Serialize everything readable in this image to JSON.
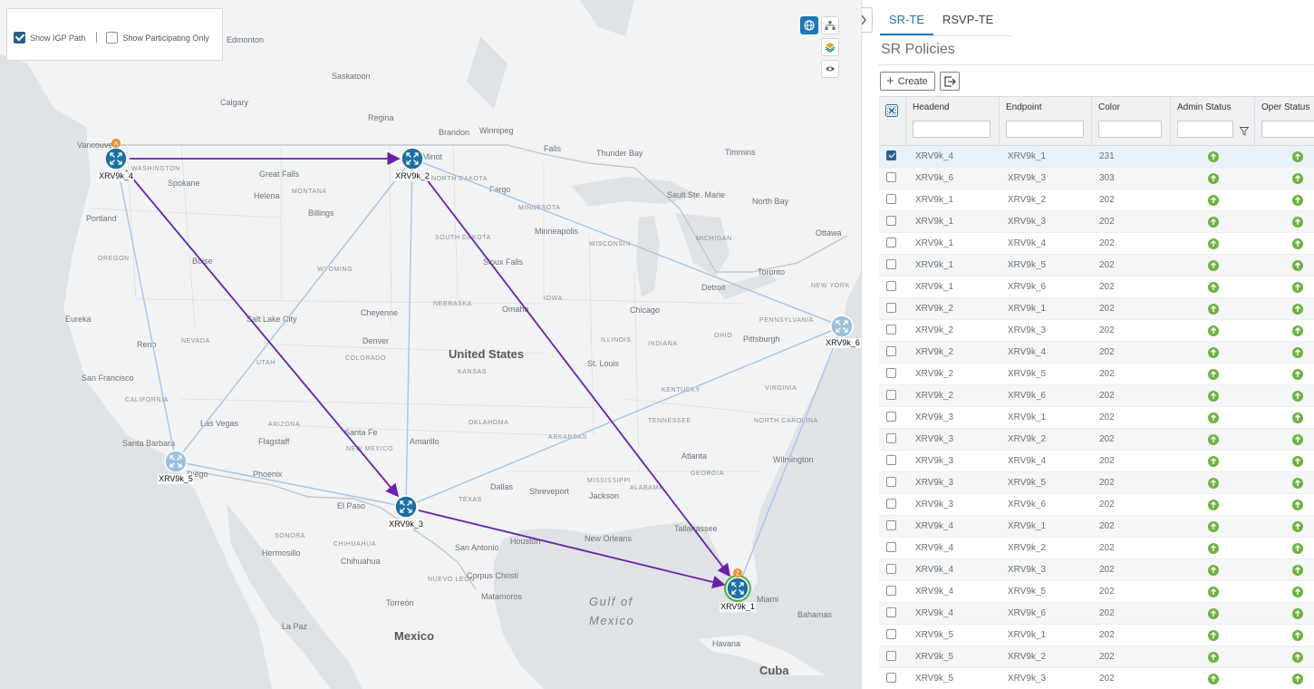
{
  "map": {
    "controls": {
      "show_igp_path": {
        "label": "Show IGP Path",
        "checked": true
      },
      "show_participating_only": {
        "label": "Show Participating Only",
        "checked": false
      }
    },
    "tool_icons": [
      "globe-icon",
      "topology-icon",
      "layers-icon",
      "eye-icon"
    ],
    "country_label": "United States",
    "mexico_label": "Mexico",
    "gulf_label_1": "Gulf of",
    "gulf_label_2": "Mexico",
    "cuba_label": "Cuba",
    "labels": {
      "edmonton": "Edmonton",
      "saskatoon": "Saskatoon",
      "calgary": "Calgary",
      "regina": "Regina",
      "brandon": "Brandon",
      "winnipeg": "Winnipeg",
      "thunder_bay": "Thunder Bay",
      "timmins": "Timmins",
      "vancouver": "Vancouver",
      "washington": "WASHINGTON",
      "spokane": "Spokane",
      "great_falls": "Great Falls",
      "helena": "Helena",
      "montana": "MONTANA",
      "billings": "Billings",
      "portland": "Portland",
      "oregon": "OREGON",
      "boise": "Boise",
      "wyoming": "WYOMING",
      "north_dakota": "NORTH DAKOTA",
      "fargo": "Fargo",
      "south_dakota": "SOUTH DAKOTA",
      "minnesota": "MINNESOTA",
      "minneapolis": "Minneapolis",
      "wisconsin": "WISCONSIN",
      "sioux_falls": "Sioux Falls",
      "michigan": "MICHIGAN",
      "ottawa": "Ottawa",
      "toronto": "Toronto",
      "new_york": "NEW YORK",
      "detroit": "Detroit",
      "chicago": "Chicago",
      "iowa": "IOWA",
      "nebraska": "NEBRASKA",
      "omaha": "Omaha",
      "illinois": "ILLINOIS",
      "indiana": "INDIANA",
      "ohio": "OHIO",
      "pittsburgh": "Pittsburgh",
      "pennsylvania": "PENNSYLVANIA",
      "eureka": "Eureka",
      "reno": "Reno",
      "nevada": "NEVADA",
      "salt_lake_city": "Salt Lake City",
      "utah": "UTAH",
      "cheyenne": "Cheyenne",
      "denver": "Denver",
      "colorado": "COLORADO",
      "kansas": "KANSAS",
      "st_louis": "St. Louis",
      "kentucky": "KENTUCKY",
      "virginia": "VIRGINIA",
      "san_francisco": "San Francisco",
      "california": "CALIFORNIA",
      "las_vegas": "Las Vegas",
      "arizona": "ARIZONA",
      "flagstaff": "Flagstaff",
      "santa_fe": "Santa Fe",
      "new_mexico": "NEW MEXICO",
      "oklahoma": "OKLAHOMA",
      "amarillo": "Amarillo",
      "arkansas": "ARKANSAS",
      "tennessee": "TENNESSEE",
      "north_carolina": "NORTH CAROLINA",
      "atlanta": "Atlanta",
      "georgia": "GEORGIA",
      "wilmington": "Wilmington",
      "santa_barbara": "Santa Barbara",
      "phoenix": "Phoenix",
      "san_diego": "Diego",
      "el_paso": "El Paso",
      "dallas": "Dallas",
      "shreveport": "Shreveport",
      "jackson": "Jackson",
      "texas": "TEXAS",
      "mississippi": "MISSISSIPPI",
      "alabama": "ALABAMA",
      "tallahassee": "Tallahassee",
      "new_orleans": "New Orleans",
      "houston": "Houston",
      "san_antonio": "San Antonio",
      "corpus_christi": "Corpus Christi",
      "sonora": "SONORA",
      "hermosillo": "Hermosillo",
      "chihuahua_state": "CHIHUAHUA",
      "chihuahua": "Chihuahua",
      "nuevo_leon": "NUEVO LEON",
      "matamoros": "Matamoros",
      "torreon": "Torreón",
      "la_paz": "La Paz",
      "miami": "Miami",
      "bahamas": "Bahamas",
      "havana": "Havana",
      "sault": "Sault Ste. Marie",
      "north_bay": "North Bay",
      "minot": "Minot",
      "falls": "Falls"
    },
    "nodes": [
      {
        "id": "XRV9k_4",
        "label": "XRV9k_4",
        "badge": "A",
        "style": "active"
      },
      {
        "id": "XRV9k_2",
        "label": "XRV9k_2",
        "badge": "",
        "style": "active"
      },
      {
        "id": "XRV9k_3",
        "label": "XRV9k_3",
        "badge": "",
        "style": "active"
      },
      {
        "id": "XRV9k_1",
        "label": "XRV9k_1",
        "badge": "Z",
        "style": "dest"
      },
      {
        "id": "XRV9k_5",
        "label": "XRV9k_5",
        "badge": "",
        "style": "inactive"
      },
      {
        "id": "XRV9k_6",
        "label": "XRV9k_6",
        "badge": "",
        "style": "inactive"
      }
    ],
    "colors": {
      "path": "#6a1fa8",
      "link": "#a9c6e8",
      "node": "#1c6fa3",
      "node_inactive": "#9cc0dc",
      "dest_ring": "#5fae45",
      "badge": "#e8922f"
    }
  },
  "panel": {
    "tabs": [
      {
        "label": "SR-TE",
        "active": true
      },
      {
        "label": "RSVP-TE",
        "active": false
      }
    ],
    "title": "SR Policies",
    "create_label": "Create",
    "columns": [
      "Headend",
      "Endpoint",
      "Color",
      "Admin Status",
      "Oper Status"
    ],
    "rows": [
      {
        "headend": "XRV9k_4",
        "endpoint": "XRV9k_1",
        "color": "231",
        "selected": true
      },
      {
        "headend": "XRV9k_6",
        "endpoint": "XRV9k_3",
        "color": "303",
        "selected": false
      },
      {
        "headend": "XRV9k_1",
        "endpoint": "XRV9k_2",
        "color": "202",
        "selected": false
      },
      {
        "headend": "XRV9k_1",
        "endpoint": "XRV9k_3",
        "color": "202",
        "selected": false
      },
      {
        "headend": "XRV9k_1",
        "endpoint": "XRV9k_4",
        "color": "202",
        "selected": false
      },
      {
        "headend": "XRV9k_1",
        "endpoint": "XRV9k_5",
        "color": "202",
        "selected": false
      },
      {
        "headend": "XRV9k_1",
        "endpoint": "XRV9k_6",
        "color": "202",
        "selected": false
      },
      {
        "headend": "XRV9k_2",
        "endpoint": "XRV9k_1",
        "color": "202",
        "selected": false
      },
      {
        "headend": "XRV9k_2",
        "endpoint": "XRV9k_3",
        "color": "202",
        "selected": false
      },
      {
        "headend": "XRV9k_2",
        "endpoint": "XRV9k_4",
        "color": "202",
        "selected": false
      },
      {
        "headend": "XRV9k_2",
        "endpoint": "XRV9k_5",
        "color": "202",
        "selected": false
      },
      {
        "headend": "XRV9k_2",
        "endpoint": "XRV9k_6",
        "color": "202",
        "selected": false
      },
      {
        "headend": "XRV9k_3",
        "endpoint": "XRV9k_1",
        "color": "202",
        "selected": false
      },
      {
        "headend": "XRV9k_3",
        "endpoint": "XRV9k_2",
        "color": "202",
        "selected": false
      },
      {
        "headend": "XRV9k_3",
        "endpoint": "XRV9k_4",
        "color": "202",
        "selected": false
      },
      {
        "headend": "XRV9k_3",
        "endpoint": "XRV9k_5",
        "color": "202",
        "selected": false
      },
      {
        "headend": "XRV9k_3",
        "endpoint": "XRV9k_6",
        "color": "202",
        "selected": false
      },
      {
        "headend": "XRV9k_4",
        "endpoint": "XRV9k_1",
        "color": "202",
        "selected": false
      },
      {
        "headend": "XRV9k_4",
        "endpoint": "XRV9k_2",
        "color": "202",
        "selected": false
      },
      {
        "headend": "XRV9k_4",
        "endpoint": "XRV9k_3",
        "color": "202",
        "selected": false
      },
      {
        "headend": "XRV9k_4",
        "endpoint": "XRV9k_5",
        "color": "202",
        "selected": false
      },
      {
        "headend": "XRV9k_4",
        "endpoint": "XRV9k_6",
        "color": "202",
        "selected": false
      },
      {
        "headend": "XRV9k_5",
        "endpoint": "XRV9k_1",
        "color": "202",
        "selected": false
      },
      {
        "headend": "XRV9k_5",
        "endpoint": "XRV9k_2",
        "color": "202",
        "selected": false
      },
      {
        "headend": "XRV9k_5",
        "endpoint": "XRV9k_3",
        "color": "202",
        "selected": false
      }
    ],
    "status_color": "#6cb33f"
  }
}
